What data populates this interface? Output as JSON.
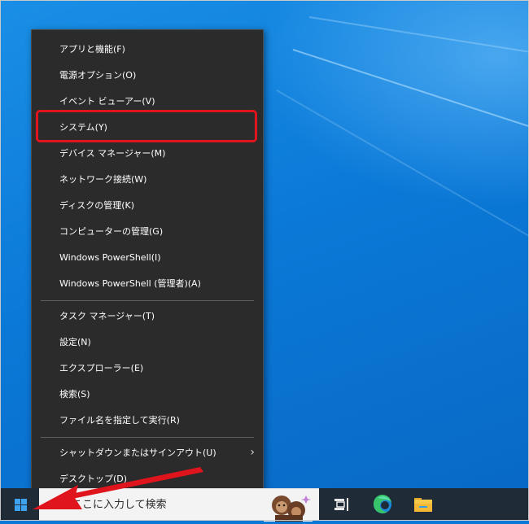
{
  "context_menu": {
    "items": [
      {
        "label": "アプリと機能(F)"
      },
      {
        "label": "電源オプション(O)"
      },
      {
        "label": "イベント ビューアー(V)"
      },
      {
        "label": "システム(Y)"
      },
      {
        "label": "デバイス マネージャー(M)"
      },
      {
        "label": "ネットワーク接続(W)"
      },
      {
        "label": "ディスクの管理(K)"
      },
      {
        "label": "コンピューターの管理(G)"
      },
      {
        "label": "Windows PowerShell(I)"
      },
      {
        "label": "Windows PowerShell (管理者)(A)"
      },
      {
        "label": "タスク マネージャー(T)"
      },
      {
        "label": "設定(N)"
      },
      {
        "label": "エクスプローラー(E)"
      },
      {
        "label": "検索(S)"
      },
      {
        "label": "ファイル名を指定して実行(R)"
      },
      {
        "label": "シャットダウンまたはサインアウト(U)"
      },
      {
        "label": "デスクトップ(D)"
      }
    ],
    "submenu_chevron": "›",
    "highlighted_item": "システム(Y)"
  },
  "taskbar": {
    "search_placeholder": "ここに入力して検索",
    "icons": [
      "windows-start-icon",
      "task-view-icon",
      "edge-browser-icon",
      "file-explorer-icon"
    ]
  },
  "colors": {
    "menu_background": "#2b2b2b",
    "highlight_border": "#e0141c",
    "annotation_arrow": "#e0141c",
    "taskbar": "#1f2b36",
    "desktop": "#0a78d7"
  }
}
